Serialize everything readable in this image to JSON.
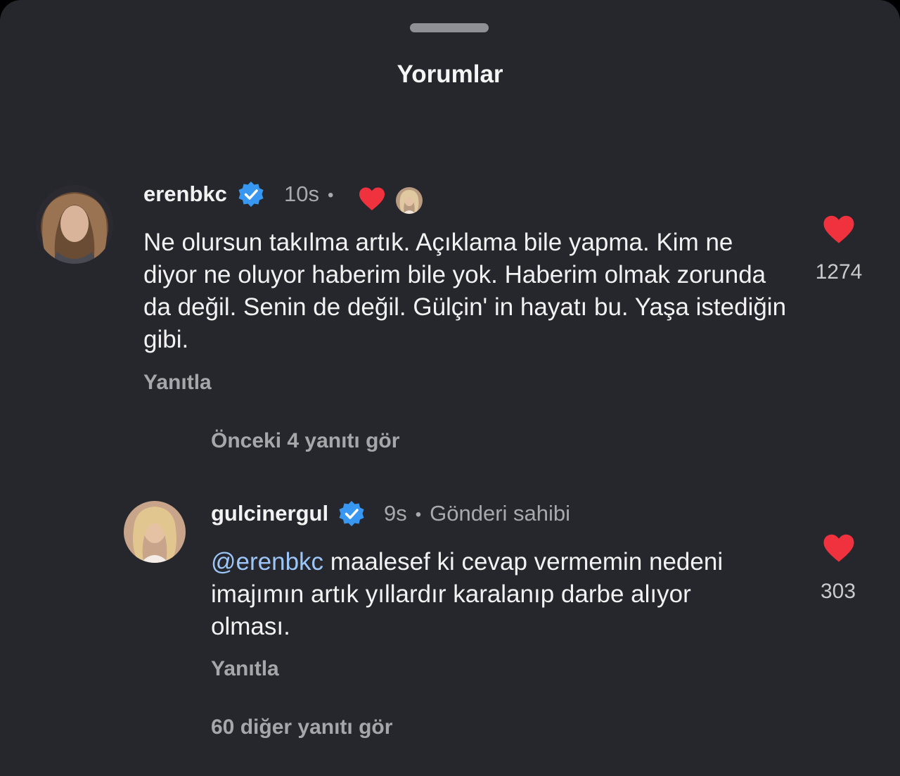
{
  "header": {
    "title": "Yorumlar"
  },
  "comments": [
    {
      "username": "erenbkc",
      "time": "10s",
      "text": "Ne olursun takılma artık.  Açıklama bile yapma. Kim ne diyor ne oluyor haberim bile yok. Haberim olmak zorunda da değil. Senin de değil. Gülçin' in hayatı bu. Yaşa istediğin gibi.",
      "likes": "1274",
      "reply_label": "Yanıtla",
      "view_replies": "Önceki 4 yanıtı gör",
      "liked_by_author": true
    },
    {
      "username": "gulcinergul",
      "time": "9s",
      "badge": "Gönderi sahibi",
      "mention": "@erenbkc",
      "text": "maalesef ki cevap vermemin nedeni imajımın artık yıllardır karalanıp darbe alıyor olması.",
      "likes": "303",
      "reply_label": "Yanıtla",
      "view_replies": "60 diğer yanıtı gör"
    }
  ],
  "colors": {
    "background": "#25272c",
    "heart": "#f0313e",
    "verified": "#3897f0",
    "mention": "#9cc6f7"
  },
  "icons": [
    "heart-icon",
    "verified-badge-icon",
    "avatar"
  ]
}
